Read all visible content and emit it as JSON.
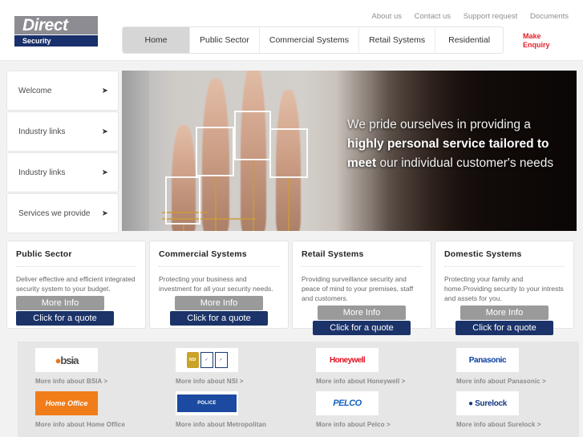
{
  "header": {
    "logo_top": "Direct",
    "logo_bottom": "Security",
    "top_links": [
      "About us",
      "Contact us",
      "Support request",
      "Documents"
    ],
    "nav": [
      {
        "label": "Home",
        "active": true
      },
      {
        "label": "Public Sector",
        "active": false
      },
      {
        "label": "Commercial Systems",
        "active": false
      },
      {
        "label": "Retail Systems",
        "active": false
      },
      {
        "label": "Residential",
        "active": false
      }
    ],
    "enquiry_line1": "Make",
    "enquiry_line2": "Enquiry"
  },
  "sidebar": {
    "items": [
      {
        "label": "Welcome",
        "arrow": "arrow-right-icon"
      },
      {
        "label": "Industry links",
        "arrow": "arrow-right-icon"
      },
      {
        "label": "Industry links",
        "arrow": "arrow-right-icon"
      },
      {
        "label": "Services we provide",
        "arrow": "arrow-right-icon"
      }
    ]
  },
  "hero": {
    "image_alt": "biometric-fingerprint-scan",
    "text_part1": "We pride ourselves in providing a ",
    "text_bold": "highly personal service tailored to meet",
    "text_part2": " our individual customer's needs"
  },
  "cards": [
    {
      "title": "Public Sector",
      "desc": "Deliver effective and efficient integrated security system to your budget.",
      "more_label": "More Info",
      "quote_label": "Click for a quote"
    },
    {
      "title": "Commercial Systems",
      "desc": "Protecting your business and investment for all your security needs.",
      "more_label": "More Info",
      "quote_label": "Click for a quote"
    },
    {
      "title": "Retail Systems",
      "desc": "Providing surveillance security and peace of mind to your premises, staff and customers.",
      "more_label": "More Info",
      "quote_label": "Click for a quote"
    },
    {
      "title": "Domestic Systems",
      "desc": "Protecting your family and home.Providing security to your intrests and assets for you.",
      "more_label": "More Info",
      "quote_label": "Click for a quote"
    }
  ],
  "partners": {
    "row1": [
      {
        "logo": "bsia-logo",
        "logo_text": "bsia",
        "link": "More info about BSIA >"
      },
      {
        "logo": "nsi-logo",
        "logo_text": "NSI",
        "link": "More info about NSI >"
      },
      {
        "logo": "honeywell-logo",
        "logo_text": "Honeywell",
        "link": "More info about Honeywell >"
      },
      {
        "logo": "panasonic-logo",
        "logo_text": "Panasonic",
        "link": "More info about Panasonic >"
      }
    ],
    "row2": [
      {
        "logo": "home-office-logo",
        "logo_text": "Home Office",
        "link": "More info about Home Office"
      },
      {
        "logo": "metropolitan-police-logo",
        "logo_text": "METROPOLITAN POLICE",
        "link": "More info about Metropolitan"
      },
      {
        "logo": "pelco-logo",
        "logo_text": "PELCO",
        "link": "More info about Pelco >"
      },
      {
        "logo": "surelock-logo",
        "logo_text": "Surelock",
        "link": "More info about Surelock >"
      }
    ]
  },
  "colors": {
    "navy": "#18306b",
    "gray_logo": "#8c8c92",
    "accent_red": "#e8202a",
    "button_gray": "#9a9a9a",
    "button_navy": "#1b3368",
    "page_bg": "#f2f2f2"
  }
}
